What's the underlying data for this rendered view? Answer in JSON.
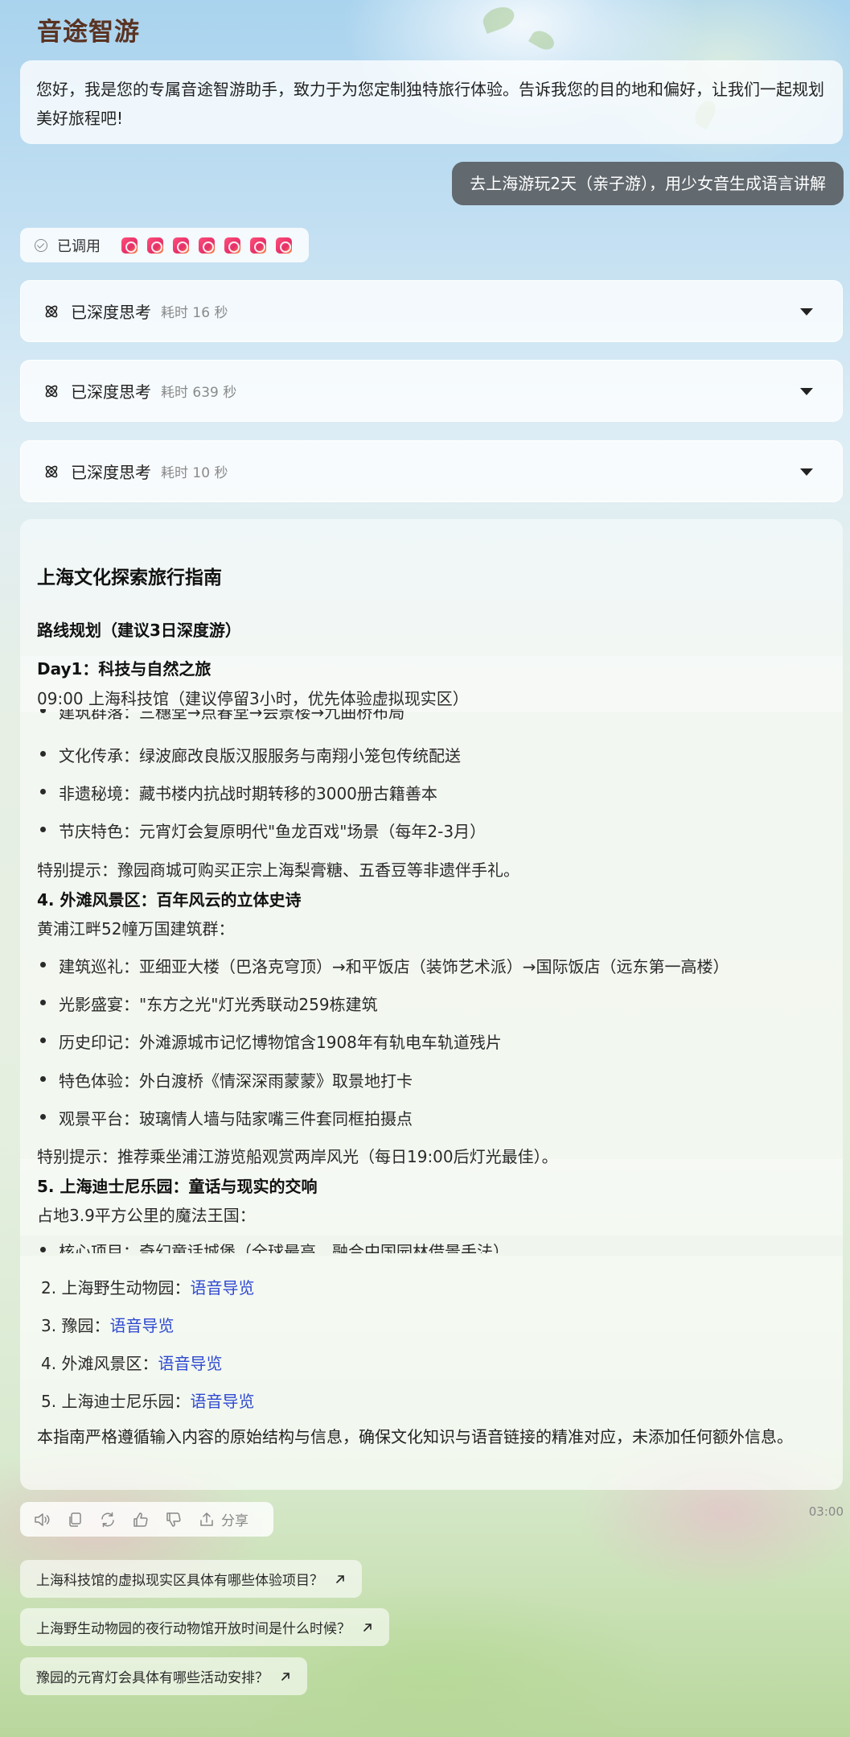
{
  "app": {
    "title": "音途智游"
  },
  "greeting": "您好，我是您的专属音途智游助手，致力于为您定制独特旅行体验。告诉我您的目的地和偏好，让我们一起规划美好旅程吧!",
  "user_message": "去上海游玩2天（亲子游），用少女音生成语言讲解",
  "tools": {
    "label": "已调用",
    "count": 7
  },
  "thinking": [
    {
      "label": "已深度思考",
      "time": "耗时 16 秒"
    },
    {
      "label": "已深度思考",
      "time": "耗时 639 秒"
    },
    {
      "label": "已深度思考",
      "time": "耗时 10 秒"
    }
  ],
  "answer": {
    "title": "上海文化探索旅行指南",
    "route_heading": "路线规划（建议3日深度游）",
    "day1_heading": "Day1：科技与自然之旅",
    "day1_line": "09:00 上海科技馆（建议停留3小时，优先体验虚拟现实区）",
    "yuyuan_partial": "建筑群落：三穗堂→点春堂→会景楼→九曲桥布局",
    "yuyuan_items": [
      "文化传承：绿波廊改良版汉服服务与南翔小笼包传统配送",
      "非遗秘境：藏书楼内抗战时期转移的3000册古籍善本",
      "节庆特色：元宵灯会复原明代\"鱼龙百戏\"场景（每年2-3月）"
    ],
    "yuyuan_tip": "特别提示：豫园商城可购买正宗上海梨膏糖、五香豆等非遗伴手礼。",
    "bund_heading": "4. 外滩风景区：百年风云的立体史诗",
    "bund_intro": "黄浦江畔52幢万国建筑群：",
    "bund_items": [
      "建筑巡礼：亚细亚大楼（巴洛克穹顶）→和平饭店（装饰艺术派）→国际饭店（远东第一高楼）",
      "光影盛宴：\"东方之光\"灯光秀联动259栋建筑",
      "历史印记：外滩源城市记忆博物馆含1908年有轨电车轨道残片",
      "特色体验：外白渡桥《情深深雨蒙蒙》取景地打卡",
      "观景平台：玻璃情人墙与陆家嘴三件套同框拍摄点"
    ],
    "bund_tip": "特别提示：推荐乘坐浦江游览船观赏两岸风光（每日19:00后灯光最佳）。",
    "disney_heading": "5. 上海迪士尼乐园：童话与现实的交响",
    "disney_intro": "占地3.9平方公里的魔法王国：",
    "disney_partial": "核心项目：奇幻童话城堡（全球最高，融合中国园林借景手法）",
    "audio_links": [
      {
        "prefix": "2. 上海野生动物园：",
        "link": "语音导览"
      },
      {
        "prefix": "3. 豫园：",
        "link": "语音导览"
      },
      {
        "prefix": "4. 外滩风景区：",
        "link": "语音导览"
      },
      {
        "prefix": "5. 上海迪士尼乐园：",
        "link": "语音导览"
      }
    ],
    "closing": "本指南严格遵循输入内容的原始结构与信息，确保文化知识与语音链接的精准对应，未添加任何额外信息。"
  },
  "actions": {
    "share_label": "分享",
    "timestamp": "03:00"
  },
  "suggestions": [
    "上海科技馆的虚拟现实区具体有哪些体验项目？",
    "上海野生动物园的夜行动物馆开放时间是什么时候？",
    "豫园的元宵灯会具体有哪些活动安排？"
  ],
  "colors": {
    "title": "#5a3322",
    "user_bubble": "#585c60",
    "link": "#2f49d1",
    "tool_icon": "#e5306a"
  },
  "icons": [
    "check-circle-icon",
    "app-logo-icon",
    "atom-icon",
    "chevron-down-icon",
    "speaker-icon",
    "copy-icon",
    "refresh-icon",
    "thumbs-up-icon",
    "thumbs-down-icon",
    "share-icon",
    "arrow-up-right-icon"
  ]
}
